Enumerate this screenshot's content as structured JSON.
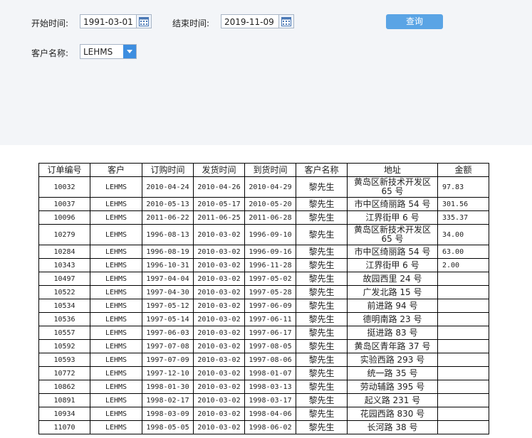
{
  "filters": {
    "start_label": "开始时间:",
    "start_value": "1991-03-01",
    "end_label": "结束时间:",
    "end_value": "2019-11-09",
    "query_label": "查询",
    "customer_label": "客户名称:",
    "customer_value": "LEHMS"
  },
  "table": {
    "headers": [
      "订单编号",
      "客户",
      "订购时间",
      "发货时间",
      "到货时间",
      "客户名称",
      "地址",
      "金额"
    ],
    "rows": [
      [
        "10032",
        "LEHMS",
        "2010-04-24",
        "2010-04-26",
        "2010-04-29",
        "黎先生",
        "黄岛区新技术开发区 65 号",
        "97.83"
      ],
      [
        "10037",
        "LEHMS",
        "2010-05-13",
        "2010-05-17",
        "2010-05-20",
        "黎先生",
        "市中区绮丽路 54 号",
        "301.56"
      ],
      [
        "10096",
        "LEHMS",
        "2011-06-22",
        "2011-06-25",
        "2011-06-28",
        "黎先生",
        "江界街甲 6 号",
        "335.37"
      ],
      [
        "10279",
        "LEHMS",
        "1996-08-13",
        "2010-03-02",
        "1996-09-10",
        "黎先生",
        "黄岛区新技术开发区 65 号",
        "34.00"
      ],
      [
        "10284",
        "LEHMS",
        "1996-08-19",
        "2010-03-02",
        "1996-09-16",
        "黎先生",
        "市中区绮丽路 54 号",
        "63.00"
      ],
      [
        "10343",
        "LEHMS",
        "1996-10-31",
        "2010-03-02",
        "1996-11-28",
        "黎先生",
        "江界街甲 6 号",
        "2.00"
      ],
      [
        "10497",
        "LEHMS",
        "1997-04-04",
        "2010-03-02",
        "1997-05-02",
        "黎先生",
        "故园西里 24 号",
        ""
      ],
      [
        "10522",
        "LEHMS",
        "1997-04-30",
        "2010-03-02",
        "1997-05-28",
        "黎先生",
        "广发北路 15 号",
        ""
      ],
      [
        "10534",
        "LEHMS",
        "1997-05-12",
        "2010-03-02",
        "1997-06-09",
        "黎先生",
        "前进路 94 号",
        ""
      ],
      [
        "10536",
        "LEHMS",
        "1997-05-14",
        "2010-03-02",
        "1997-06-11",
        "黎先生",
        "德明南路 23 号",
        ""
      ],
      [
        "10557",
        "LEHMS",
        "1997-06-03",
        "2010-03-02",
        "1997-06-17",
        "黎先生",
        "挺进路 83 号",
        ""
      ],
      [
        "10592",
        "LEHMS",
        "1997-07-08",
        "2010-03-02",
        "1997-08-05",
        "黎先生",
        "黄岛区青年路 37 号",
        ""
      ],
      [
        "10593",
        "LEHMS",
        "1997-07-09",
        "2010-03-02",
        "1997-08-06",
        "黎先生",
        "实验西路 293 号",
        ""
      ],
      [
        "10772",
        "LEHMS",
        "1997-12-10",
        "2010-03-02",
        "1998-01-07",
        "黎先生",
        "统一路 35 号",
        ""
      ],
      [
        "10862",
        "LEHMS",
        "1998-01-30",
        "2010-03-02",
        "1998-03-13",
        "黎先生",
        "劳动辅路 395 号",
        ""
      ],
      [
        "10891",
        "LEHMS",
        "1998-02-17",
        "2010-03-02",
        "1998-03-17",
        "黎先生",
        "起义路 231 号",
        ""
      ],
      [
        "10934",
        "LEHMS",
        "1998-03-09",
        "2010-03-02",
        "1998-04-06",
        "黎先生",
        "花园西路 830 号",
        ""
      ],
      [
        "11070",
        "LEHMS",
        "1998-05-05",
        "2010-03-02",
        "1998-06-02",
        "黎先生",
        "长河路 38 号",
        ""
      ]
    ]
  },
  "icons": {
    "calendar": "calendar-icon",
    "dropdown": "chevron-down-icon"
  },
  "colors": {
    "panel_bg": "#f3f5f8",
    "button_bg": "#5aa4e5",
    "dropdown_bg": "#3d8ee0"
  }
}
